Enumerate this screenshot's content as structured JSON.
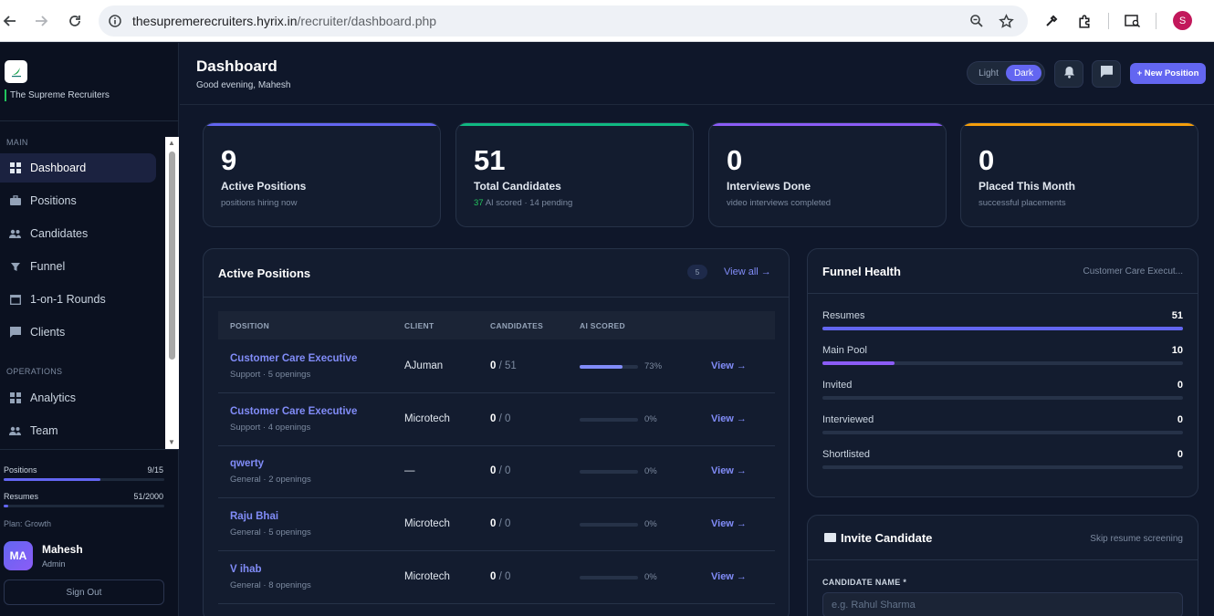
{
  "browser": {
    "url_host": "thesupremerecruiters.hyrix.in",
    "url_path": "/recruiter/dashboard.php",
    "profile_initial": "S"
  },
  "sidebar": {
    "brand": "The Supreme Recruiters",
    "section_main": "MAIN",
    "section_operations": "OPERATIONS",
    "items": [
      {
        "label": "Dashboard",
        "icon": "grid-icon",
        "active": true
      },
      {
        "label": "Positions",
        "icon": "briefcase-icon"
      },
      {
        "label": "Candidates",
        "icon": "people-icon"
      },
      {
        "label": "Funnel",
        "icon": "funnel-icon"
      },
      {
        "label": "1-on-1 Rounds",
        "icon": "calendar-icon"
      },
      {
        "label": "Clients",
        "icon": "chat-icon"
      },
      {
        "label": "Analytics",
        "icon": "grid-icon"
      },
      {
        "label": "Team",
        "icon": "people-icon"
      }
    ],
    "usage": {
      "positions_label": "Positions",
      "positions_value": "9/15",
      "positions_fraction": 0.6,
      "resumes_label": "Resumes",
      "resumes_value": "51/2000",
      "resumes_fraction": 0.026
    },
    "plan": "Plan: Growth",
    "user": {
      "initials": "MA",
      "name": "Mahesh",
      "role": "Admin"
    },
    "sign_out": "Sign Out"
  },
  "header": {
    "title": "Dashboard",
    "greeting": "Good evening, Mahesh",
    "theme_light": "Light",
    "theme_dark": "Dark",
    "new_position": "+ New Position"
  },
  "stats": [
    {
      "value": "9",
      "label": "Active Positions",
      "sub": "positions hiring now",
      "color": "#6366f1"
    },
    {
      "value": "51",
      "label": "Total Candidates",
      "sub_green": "37",
      "sub": " AI scored · 14 pending",
      "color": "#10b981"
    },
    {
      "value": "0",
      "label": "Interviews Done",
      "sub": "video interviews completed",
      "color": "#8b5cf6"
    },
    {
      "value": "0",
      "label": "Placed This Month",
      "sub": "successful placements",
      "color": "#f59e0b"
    }
  ],
  "active_positions": {
    "title": "Active Positions",
    "count": "5",
    "view_all": "View all →",
    "columns": [
      "POSITION",
      "CLIENT",
      "CANDIDATES",
      "AI SCORED"
    ],
    "rows": [
      {
        "name": "Customer Care Executive",
        "meta": "Support · 5 openings",
        "client": "AJuman",
        "cand": "0",
        "total": " / 51",
        "ai_pct": "73%",
        "ai_fraction": 0.73,
        "view": "View →"
      },
      {
        "name": "Customer Care Executive",
        "meta": "Support · 4 openings",
        "client": "Microtech",
        "cand": "0",
        "total": " / 0",
        "ai_pct": "0%",
        "ai_fraction": 0,
        "view": "View →"
      },
      {
        "name": "qwerty",
        "meta": "General · 2 openings",
        "client": "—",
        "cand": "0",
        "total": " / 0",
        "ai_pct": "0%",
        "ai_fraction": 0,
        "view": "View →"
      },
      {
        "name": "Raju Bhai",
        "meta": "General · 5 openings",
        "client": "Microtech",
        "cand": "0",
        "total": " / 0",
        "ai_pct": "0%",
        "ai_fraction": 0,
        "view": "View →"
      },
      {
        "name": "V ihab",
        "meta": "General · 8 openings",
        "client": "Microtech",
        "cand": "0",
        "total": " / 0",
        "ai_pct": "0%",
        "ai_fraction": 0,
        "view": "View →"
      }
    ]
  },
  "funnel": {
    "title": "Funnel Health",
    "position": "Customer Care Execut...",
    "stages": [
      {
        "label": "Resumes",
        "value": "51",
        "fraction": 1.0,
        "color": "#6366f1"
      },
      {
        "label": "Main Pool",
        "value": "10",
        "fraction": 0.2,
        "color": "#8b5cf6"
      },
      {
        "label": "Invited",
        "value": "0",
        "fraction": 0,
        "color": "#6366f1"
      },
      {
        "label": "Interviewed",
        "value": "0",
        "fraction": 0,
        "color": "#6366f1"
      },
      {
        "label": "Shortlisted",
        "value": "0",
        "fraction": 0,
        "color": "#6366f1"
      }
    ]
  },
  "invite": {
    "title": "Invite Candidate",
    "skip": "Skip resume screening",
    "field_label": "CANDIDATE NAME *",
    "placeholder": "e.g. Rahul Sharma"
  }
}
